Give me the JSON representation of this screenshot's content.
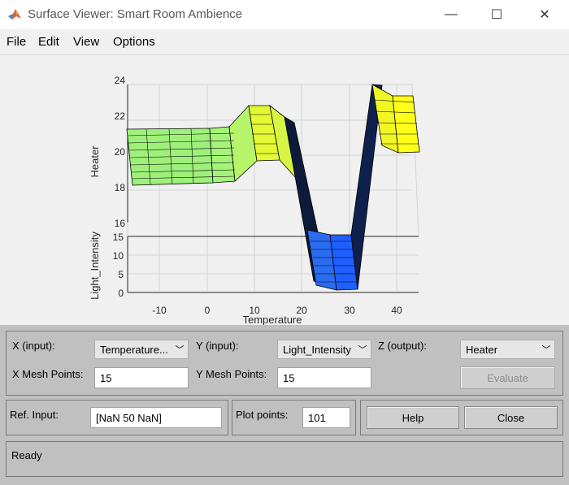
{
  "window": {
    "title": "Surface Viewer: Smart Room Ambience",
    "app_icon": "matlab-logo-icon",
    "minimize_glyph": "—",
    "maximize_glyph": "☐",
    "close_glyph": "✕"
  },
  "menu": {
    "file": "File",
    "edit": "Edit",
    "view": "View",
    "options": "Options"
  },
  "plot": {
    "z_label": "Heater",
    "y_label": "Light_Intensity",
    "x_label": "Temperature",
    "z_ticks": [
      "24",
      "22",
      "20",
      "18",
      "16"
    ],
    "y_ticks": [
      "15",
      "10",
      "5",
      "0"
    ],
    "x_ticks": [
      "-10",
      "0",
      "10",
      "20",
      "30",
      "40"
    ]
  },
  "chart_data": {
    "type": "surface",
    "xlabel": "Temperature",
    "ylabel": "Light_Intensity",
    "zlabel": "Heater",
    "x_ticks": [
      -10,
      0,
      10,
      20,
      30,
      40
    ],
    "y_ticks": [
      0,
      5,
      10,
      15
    ],
    "z_ticks": [
      16,
      18,
      20,
      22,
      24
    ],
    "surface_profile": {
      "x": [
        -16,
        0,
        6,
        9,
        14,
        22,
        27,
        31,
        36,
        40,
        44
      ],
      "z": [
        21,
        21,
        21,
        22.5,
        22.5,
        12.5,
        12.5,
        12.5,
        24,
        23,
        23
      ]
    },
    "colormap": {
      "low": "#1f5fff",
      "mid": "#a8f078",
      "high": "#ffff1a"
    }
  },
  "controls": {
    "x_input_label": "X (input):",
    "x_input_value": "Temperature...",
    "y_input_label": "Y (input):",
    "y_input_value": "Light_Intensity",
    "z_output_label": "Z (output):",
    "z_output_value": "Heater",
    "x_mesh_label": "X Mesh Points:",
    "x_mesh_value": "15",
    "y_mesh_label": "Y Mesh Points:",
    "y_mesh_value": "15",
    "evaluate_label": "Evaluate",
    "ref_input_label": "Ref. Input:",
    "ref_input_value": "[NaN 50 NaN]",
    "plot_points_label": "Plot points:",
    "plot_points_value": "101",
    "help_label": "Help",
    "close_label": "Close",
    "status_text": "Ready",
    "dropdown_arrow": "﹀"
  }
}
